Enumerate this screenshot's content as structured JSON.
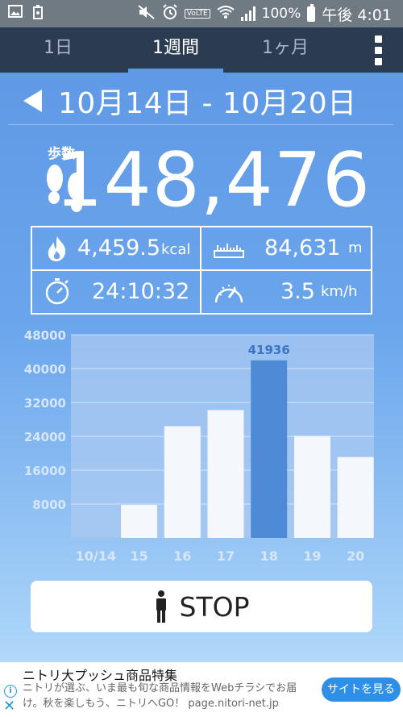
{
  "status_bar": {
    "left_icons": [
      "image-icon",
      "recycle-icon"
    ],
    "right_icons": [
      "mute-icon",
      "alarm-icon",
      "volte-icon",
      "wifi-icon",
      "signal-icon",
      "battery-icon"
    ],
    "volte_label": "VoLTE",
    "battery_percent": "100%",
    "battery_level": 1.0,
    "time": "午後 4:01"
  },
  "tabs": [
    {
      "label": "1日",
      "selected": false
    },
    {
      "label": "1週間",
      "selected": true
    },
    {
      "label": "1ヶ月",
      "selected": false
    }
  ],
  "header": {
    "date_range": "10月14日 - 10月20日"
  },
  "steps": {
    "label": "歩数",
    "value": "148,476"
  },
  "stats": {
    "calories": {
      "value": "4,459.5",
      "unit": "kcal",
      "icon": "flame-icon"
    },
    "distance": {
      "value": "84,631",
      "unit": "m",
      "icon": "ruler-icon"
    },
    "duration": {
      "value": "24:10:32",
      "icon": "stopwatch-icon"
    },
    "speed": {
      "value": "3.5",
      "unit": "km/h",
      "icon": "speedometer-icon"
    }
  },
  "chart_data": {
    "type": "bar",
    "categories": [
      "10/14",
      "15",
      "16",
      "17",
      "18",
      "19",
      "20"
    ],
    "values": [
      0,
      7800,
      26400,
      30200,
      41936,
      24100,
      19100
    ],
    "highlight_index": 4,
    "highlight_label": "41936",
    "ylim": [
      0,
      48000
    ],
    "yticks": [
      "8000",
      "16000",
      "24000",
      "32000",
      "40000",
      "48000"
    ],
    "grid": true,
    "colors": {
      "bar": "#f4f8fd",
      "highlight": "#4f8ad6",
      "plot_bg": "#a9c9f2"
    }
  },
  "stop_button": {
    "label": "STOP",
    "icon": "person-icon"
  },
  "ad": {
    "title": "ニトリ大プッシュ商品特集",
    "body": "ニトリが選ぶ、いま最も旬な商品情報をWebチラシでお届け。秋を楽しもう、ニトリへGO！ page.nitori-net.jp",
    "button": "サイトを見る",
    "info_icon": "info-icon",
    "close_icon": "close-icon"
  },
  "colors": {
    "status_bar": "#6f7a83",
    "tab_bar": "#2b3c52",
    "tab_indicator": "#5a9bea",
    "ad_button": "#2e8fe8"
  }
}
